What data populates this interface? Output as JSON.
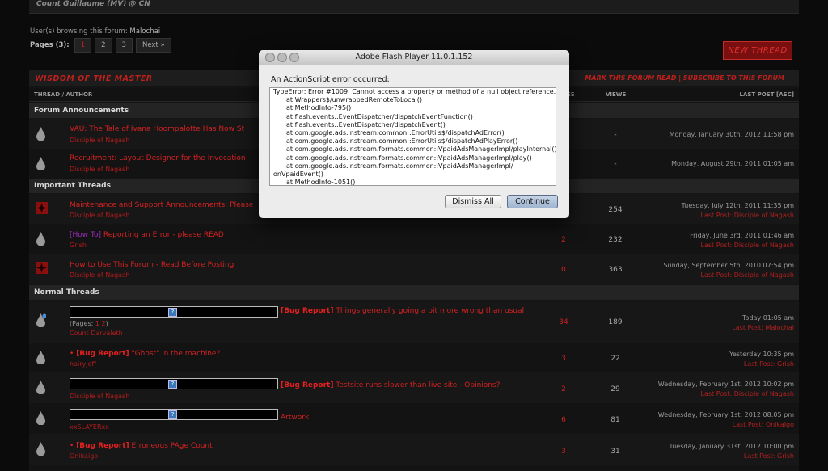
{
  "header_bar": {
    "text": "Count Guillaume (MV) @ CN"
  },
  "browsing": {
    "label": "User(s) browsing this forum:",
    "users": "Malochai"
  },
  "pagination": {
    "label": "Pages (3):",
    "pages": [
      "1",
      "2",
      "3"
    ],
    "current": "1",
    "next": "Next »"
  },
  "new_thread_label": "NEW THREAD",
  "forum": {
    "title": "WISDOM OF THE MASTER",
    "links": "MARK THIS FORUM READ | SUBSCRIBE TO THIS FORUM",
    "columns": {
      "thread": "THREAD / AUTHOR",
      "replies": "ES",
      "views": "VIEWS",
      "last_post": "LAST POST [ASC]"
    }
  },
  "sections": {
    "announcements": "Forum Announcements",
    "important": "Important Threads",
    "normal": "Normal Threads"
  },
  "rows": {
    "a1": {
      "title": "VAU: The Tale of Ivana Hoompalotte Has Now St",
      "author": "Disciple of Nagash",
      "views": "-",
      "date": "Monday, January 30th, 2012 11:58 pm"
    },
    "a2": {
      "title": "Recruitment: Layout Designer for the Invocation",
      "author": "Disciple of Nagash",
      "views": "-",
      "date": "Monday, August 29th, 2011 01:05 am"
    },
    "i1": {
      "title": "Maintenance and Support Announcements: Please",
      "author": "Disciple of Nagash",
      "views": "254",
      "date": "Tuesday, July 12th, 2011 11:35 pm",
      "lp_label": "Last Post:",
      "lp_user": "Disciple of Nagash"
    },
    "i2": {
      "prefix": "[How To]",
      "title": "Reporting an Error - please READ",
      "author": "Grish",
      "replies": "2",
      "views": "232",
      "date": "Friday, June 3rd, 2011 01:46 am",
      "lp_label": "Last Post:",
      "lp_user": "Disciple of Nagash"
    },
    "i3": {
      "title": "How to Use This Forum - Read Before Posting",
      "author": "Disciple of Nagash",
      "replies": "0",
      "views": "363",
      "date": "Sunday, September 5th, 2010 07:54 pm",
      "lp_label": "Last Post:",
      "lp_user": "Disciple of Nagash"
    },
    "n1": {
      "prefix": "[Bug Report]",
      "title": "Things generally going a bit more wrong than usual",
      "pages_label": "(Pages:",
      "page1": "1",
      "page2": "2",
      "pages_end": ")",
      "author": "Count Darvaleth",
      "replies": "34",
      "views": "189",
      "date": "Today 01:05 am",
      "lp_label": "Last Post:",
      "lp_user": "Malochai"
    },
    "n2": {
      "prefix": "[Bug Report]",
      "title": "\"Ghost\" in the machine?",
      "author": "hairyjeff",
      "replies": "3",
      "views": "22",
      "date": "Yesterday 10:35 pm",
      "lp_label": "Last Post:",
      "lp_user": "Grish"
    },
    "n3": {
      "prefix": "[Bug Report]",
      "title": "Testsite runs slower than live site - Opinions?",
      "author": "Disciple of Nagash",
      "replies": "2",
      "views": "29",
      "date": "Wednesday, February 1st, 2012 10:02 pm",
      "lp_label": "Last Post:",
      "lp_user": "Disciple of Nagash"
    },
    "n4": {
      "title": "Artwork",
      "author": "xxSLAYERxx",
      "replies": "6",
      "views": "81",
      "date": "Wednesday, February 1st, 2012 08:05 pm",
      "lp_label": "Last Post:",
      "lp_user": "Onikaigo"
    },
    "n5": {
      "prefix": "[Bug Report]",
      "title": "Erroneous PAge Count",
      "author": "Onikaigo",
      "replies": "3",
      "views": "31",
      "date": "Tuesday, January 31st, 2012 10:00 pm",
      "lp_label": "Last Post:",
      "lp_user": "Grish"
    }
  },
  "dialog": {
    "title": "Adobe Flash Player 11.0.1.152",
    "message": "An ActionScript error occurred:",
    "trace": [
      "TypeError: Error #1009: Cannot access a property or method of a null object reference.",
      "at Wrappers$/unwrappedRemoteToLocal()",
      "at MethodInfo-795()",
      "at flash.events::EventDispatcher/dispatchEventFunction()",
      "at flash.events::EventDispatcher/dispatchEvent()",
      "at com.google.ads.instream.common::ErrorUtils$/dispatchAdError()",
      "at com.google.ads.instream.common::ErrorUtils$/dispatchAdPlayError()",
      "at com.google.ads.instream.formats.common::VpaidAdsManagerImpl/playInternal()",
      "at com.google.ads.instream.formats.common::VpaidAdsManagerImpl/play()",
      "at com.google.ads.instream.formats.common::VpaidAdsManagerImpl/",
      "onVpaidEvent()",
      "at MethodInfo-1051()"
    ],
    "dismiss_label": "Dismiss All",
    "continue_label": "Continue"
  },
  "colors": {
    "accent_red": "#d22222",
    "page_bg": "#0b0b0b",
    "dialog_bg": "#ececec"
  }
}
